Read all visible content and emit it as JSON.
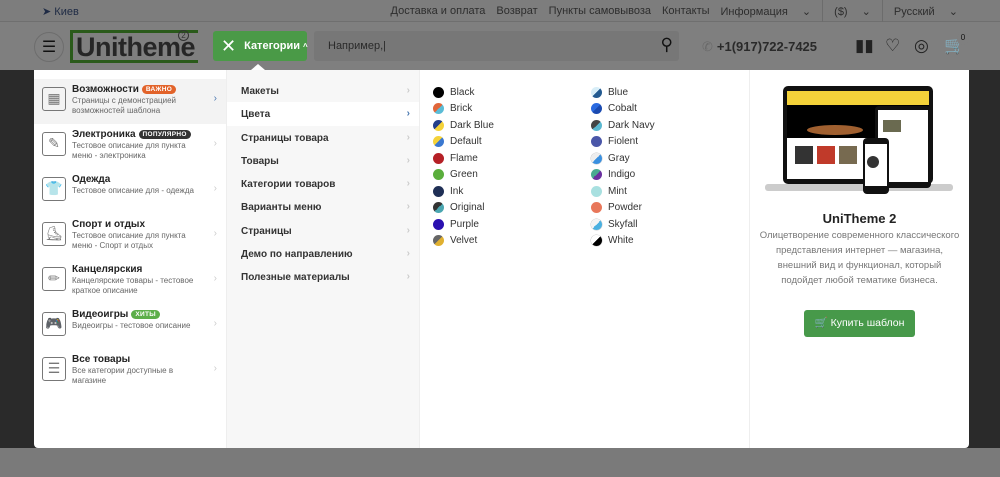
{
  "topbar": {
    "city": "Киев",
    "links": [
      "Доставка и оплата",
      "Возврат",
      "Пункты самовывоза",
      "Контакты",
      "Информация"
    ],
    "currency": "($)",
    "language": "Русский"
  },
  "header": {
    "logo": "Unitheme",
    "logo_sup": "2",
    "categories_label": "Категории",
    "search_placeholder": "Например,|",
    "phone": "+1(917)722-7425",
    "cart_count": "0"
  },
  "menu": {
    "categories": [
      {
        "title": "Возможности",
        "badge": "ВАЖНО",
        "badge_color": "#e2632a",
        "desc": "Страницы с демонстрацией возможностей шаблона",
        "icon": "features-icon",
        "active": true
      },
      {
        "title": "Электроника",
        "badge": "ПОПУЛЯРНО",
        "badge_color": "#333333",
        "desc": "Тестовое описание для пункта меню - электроника",
        "icon": "electronics-icon"
      },
      {
        "title": "Одежда",
        "badge": "",
        "desc": "Тестовое описание для - одежда",
        "icon": "tshirt-icon"
      },
      {
        "title": "Спорт и отдых",
        "badge": "",
        "desc": "Тестовое описание для пункта меню - Спорт и отдых",
        "icon": "rollerskate-icon"
      },
      {
        "title": "Канцелярския",
        "badge": "",
        "desc": "Канцелярские товары - тестовое краткое описание",
        "icon": "pencil-icon"
      },
      {
        "title": "Видеоигры",
        "badge": "ХИТЫ",
        "badge_color": "#5cae4a",
        "desc": "Видеоигры - тестовое описание",
        "icon": "gamepad-icon"
      },
      {
        "title": "Все товары",
        "badge": "",
        "desc": "Все категории доступные в магазине",
        "icon": "list-icon"
      }
    ],
    "subitems": [
      "Макеты",
      "Цвета",
      "Страницы товара",
      "Товары",
      "Категории товаров",
      "Варианты меню",
      "Страницы",
      "Демо по направлению",
      "Полезные материалы"
    ],
    "colors_left": [
      {
        "name": "Black",
        "c1": "#000000",
        "c2": "#000000"
      },
      {
        "name": "Brick",
        "c1": "#e0663a",
        "c2": "#5bbcd6"
      },
      {
        "name": "Dark Blue",
        "c1": "#243f8a",
        "c2": "#f4d23a"
      },
      {
        "name": "Default",
        "c1": "#f4d23a",
        "c2": "#3a78d0"
      },
      {
        "name": "Flame",
        "c1": "#b52026",
        "c2": "#b52026"
      },
      {
        "name": "Green",
        "c1": "#5aae3c",
        "c2": "#5aae3c"
      },
      {
        "name": "Ink",
        "c1": "#1f2f55",
        "c2": "#1f2f55"
      },
      {
        "name": "Original",
        "c1": "#333333",
        "c2": "#4aa6b0"
      },
      {
        "name": "Purple",
        "c1": "#2a10b0",
        "c2": "#2a10b0"
      },
      {
        "name": "Velvet",
        "c1": "#666666",
        "c2": "#e0b030"
      }
    ],
    "colors_right": [
      {
        "name": "Blue",
        "c1": "#d8eef8",
        "c2": "#235a90"
      },
      {
        "name": "Cobalt",
        "c1": "#2a6ae0",
        "c2": "#1a4ab0"
      },
      {
        "name": "Dark Navy",
        "c1": "#444444",
        "c2": "#5ab8d0"
      },
      {
        "name": "Fiolent",
        "c1": "#4a56a8",
        "c2": "#4a56a8"
      },
      {
        "name": "Gray",
        "c1": "#eeeeee",
        "c2": "#3a90e0"
      },
      {
        "name": "Indigo",
        "c1": "#4aaa90",
        "c2": "#6a30a0"
      },
      {
        "name": "Mint",
        "c1": "#a8e0e0",
        "c2": "#a8e0e0"
      },
      {
        "name": "Powder",
        "c1": "#e8775a",
        "c2": "#e8775a"
      },
      {
        "name": "Skyfall",
        "c1": "#f4f4f4",
        "c2": "#4ab0e0"
      },
      {
        "name": "White",
        "c1": "#ffffff",
        "c2": "#000000"
      }
    ],
    "promo": {
      "title": "UniTheme 2",
      "text": "Олицетворение современного классического представления интернет — магазина, внешний вид и функционал, который подойдет любой тематике бизнеса.",
      "button": "Купить шаблон"
    }
  }
}
